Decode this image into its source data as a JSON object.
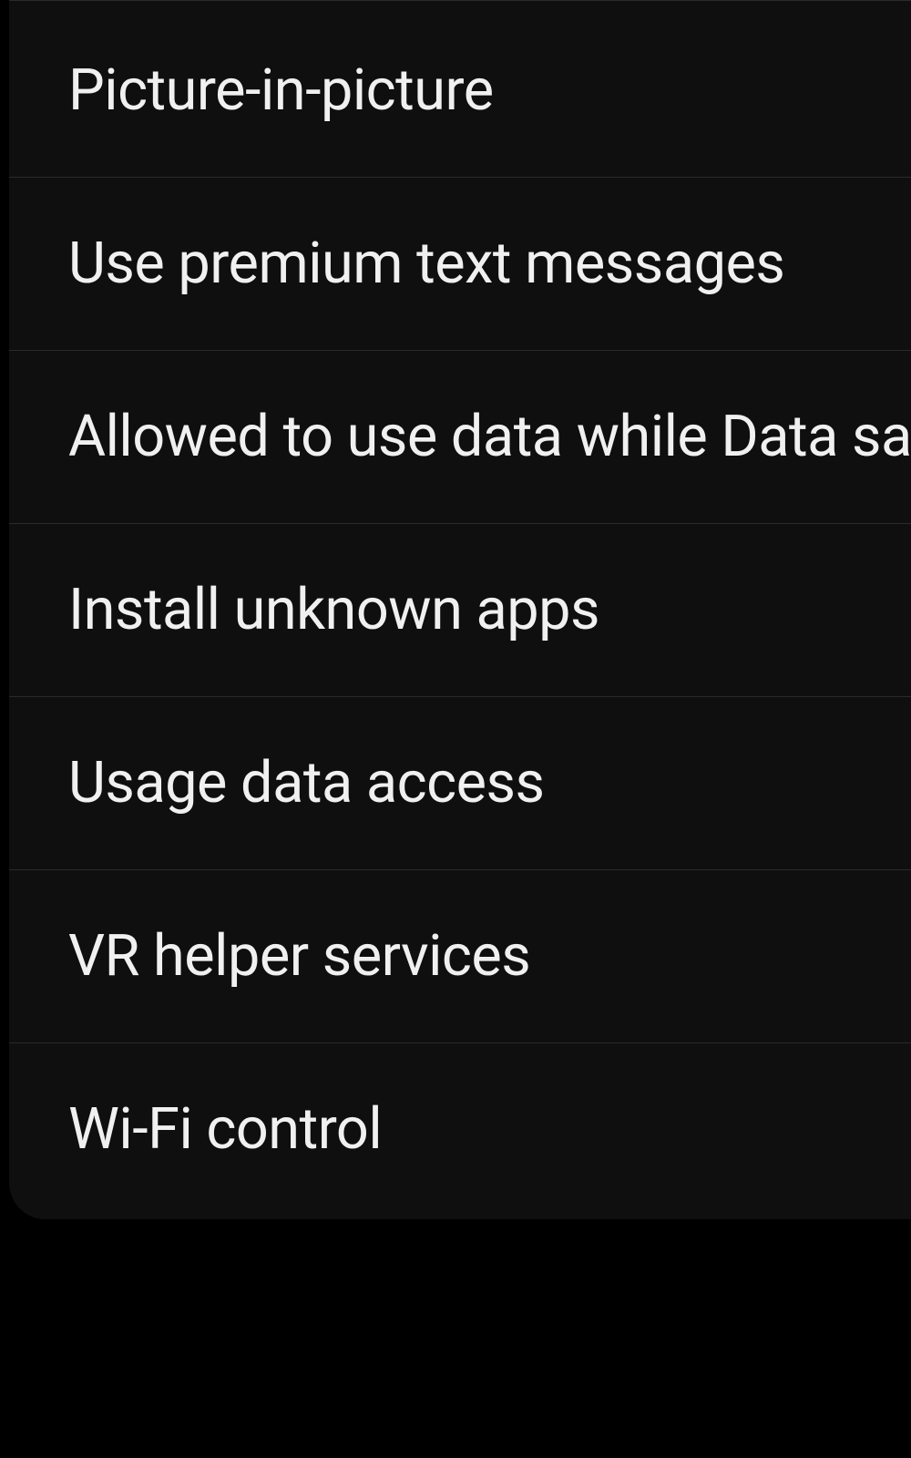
{
  "settings": {
    "items": [
      {
        "label": "Picture-in-picture"
      },
      {
        "label": "Use premium text messages"
      },
      {
        "label": "Allowed to use data while Data saver is on"
      },
      {
        "label": "Install unknown apps"
      },
      {
        "label": "Usage data access"
      },
      {
        "label": "VR helper services"
      },
      {
        "label": "Wi-Fi control"
      }
    ]
  }
}
